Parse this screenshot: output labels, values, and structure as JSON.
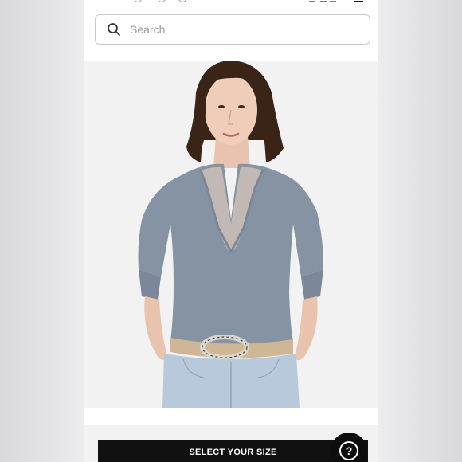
{
  "search": {
    "placeholder": "Search"
  },
  "product": {
    "image_alt": "Model wearing grey V-neck sweater with lace trim, light denim jeans and belt"
  },
  "cta": {
    "select_size_label": "SELECT YOUR SIZE"
  },
  "help": {
    "glyph": "?"
  },
  "icons": {
    "menu": "hamburger-icon",
    "search": "search-icon",
    "help": "question-mark-icon"
  }
}
